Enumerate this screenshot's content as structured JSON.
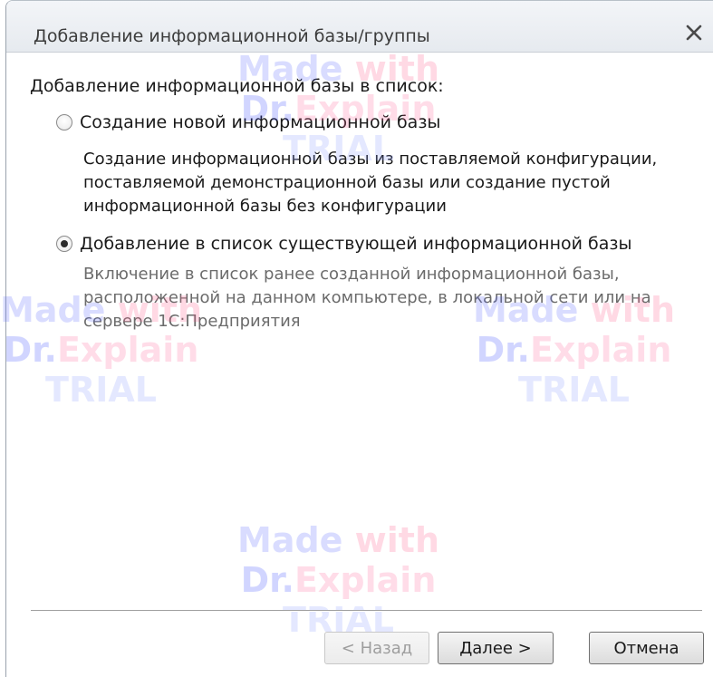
{
  "window": {
    "title": "Добавление информационной базы/группы",
    "close_glyph": "×"
  },
  "content": {
    "heading": "Добавление информационной базы в список:",
    "options": [
      {
        "label": "Создание новой информационной базы",
        "selected": false,
        "description_lines": [
          "Создание информационной базы из поставляемой конфигурации,",
          "поставляемой демонстрационной базы или создание пустой",
          "информационной базы без конфигурации"
        ]
      },
      {
        "label": "Добавление в список существующей информационной базы",
        "selected": true,
        "description_lines": [
          "Включение в список ранее созданной информационной базы,",
          "расположенной на данном компьютере,  в локальной сети или на",
          "сервере 1С:Предприятия"
        ]
      }
    ]
  },
  "buttons": {
    "back": "< Назад",
    "next": "Далее >",
    "cancel": "Отмена"
  },
  "watermark": {
    "line1a": "Made",
    "line1b": "with",
    "line2a": "Dr.",
    "line2b": "Explain",
    "line3": "TRIAL"
  },
  "colors": {
    "titlebar_text": "#3c3c3c",
    "text": "#1a1a1a",
    "disabled_text": "#9e9e9e"
  }
}
